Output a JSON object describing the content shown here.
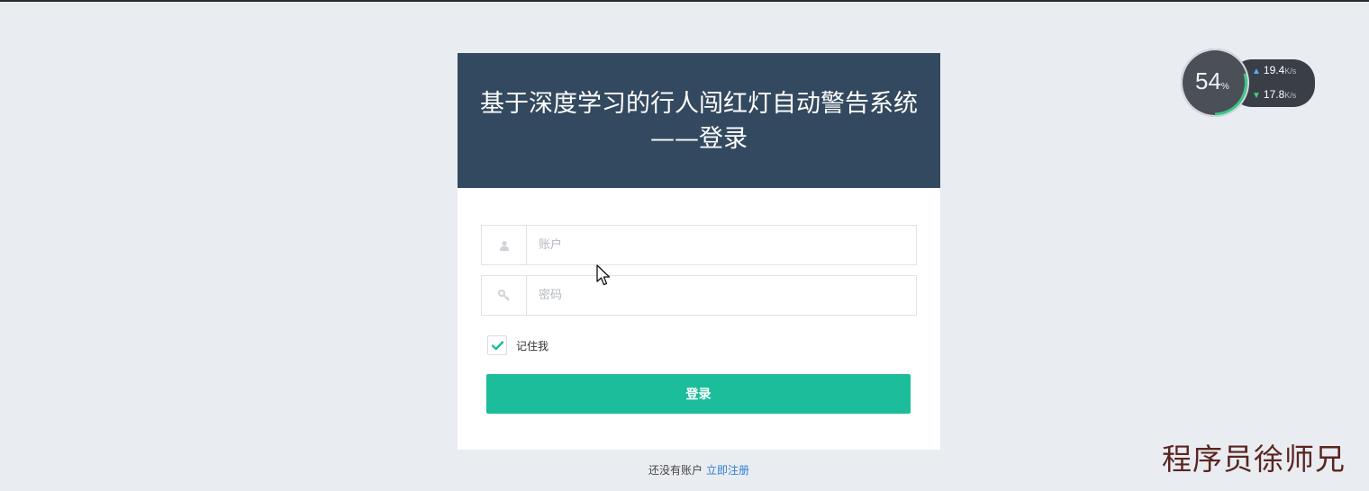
{
  "header": {
    "title_line1": "基于深度学习的行人闯红灯自动警告系统",
    "title_line2": "——登录"
  },
  "form": {
    "username_placeholder": "账户",
    "username_icon": "user-icon",
    "password_placeholder": "密码",
    "password_icon": "key-icon",
    "remember_label": "记住我",
    "remember_checked": true,
    "login_label": "登录"
  },
  "footer": {
    "no_account_text": "还没有账户",
    "register_link": "立即注册"
  },
  "network_widget": {
    "cpu_percent": "54",
    "percent_sign": "%",
    "upload_speed": "19.4",
    "download_speed": "17.8",
    "unit": "K/s"
  },
  "watermark": "程序员徐师兄",
  "colors": {
    "header_bg": "#33495f",
    "accent": "#1bbd9b",
    "link": "#2f7fd0",
    "page_bg": "#e9ecf1"
  }
}
